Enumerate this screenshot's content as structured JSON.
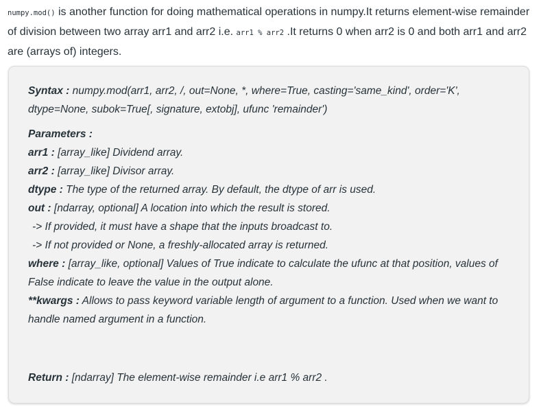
{
  "intro": {
    "func_code": "numpy.mod()",
    "text1": " is another function for doing mathematical operations in numpy.It returns element-wise remainder of division between two array arr1 and arr2 i.e. ",
    "expr_code": "arr1 % arr2",
    "text2": " .It returns 0 when arr2 is 0 and both arr1 and arr2 are (arrays of) integers."
  },
  "syntax": {
    "label": "Syntax :",
    "text": " numpy.mod(arr1, arr2, /, out=None, *, where=True, casting='same_kind', order='K', dtype=None, subok=True[, signature, extobj], ufunc 'remainder')"
  },
  "parameters": {
    "heading": "Parameters :",
    "items": [
      {
        "label": "arr1 :",
        "text": " [array_like] Dividend array."
      },
      {
        "label": "arr2 :",
        "text": " [array_like] Divisor array."
      },
      {
        "label": "dtype :",
        "text": " The type of the returned array. By default, the dtype of arr is used."
      },
      {
        "label": "out :",
        "text": " [ndarray, optional] A location into which the result is stored."
      }
    ],
    "out_notes": [
      "-> If provided, it must have a shape that the inputs broadcast to.",
      "-> If not provided or None, a freshly-allocated array is returned."
    ],
    "where": {
      "label": "where :",
      "text": " [array_like, optional] Values of True indicate to calculate the ufunc at that position, values of False indicate to leave the value in the output alone."
    },
    "kwargs": {
      "label": "**kwargs :",
      "text": " Allows to pass keyword variable length of argument to a function. Used when we want to handle named argument in a function."
    }
  },
  "return": {
    "label": "Return :",
    "text": " [ndarray] The element-wise remainder i.e arr1 % arr2 ."
  }
}
